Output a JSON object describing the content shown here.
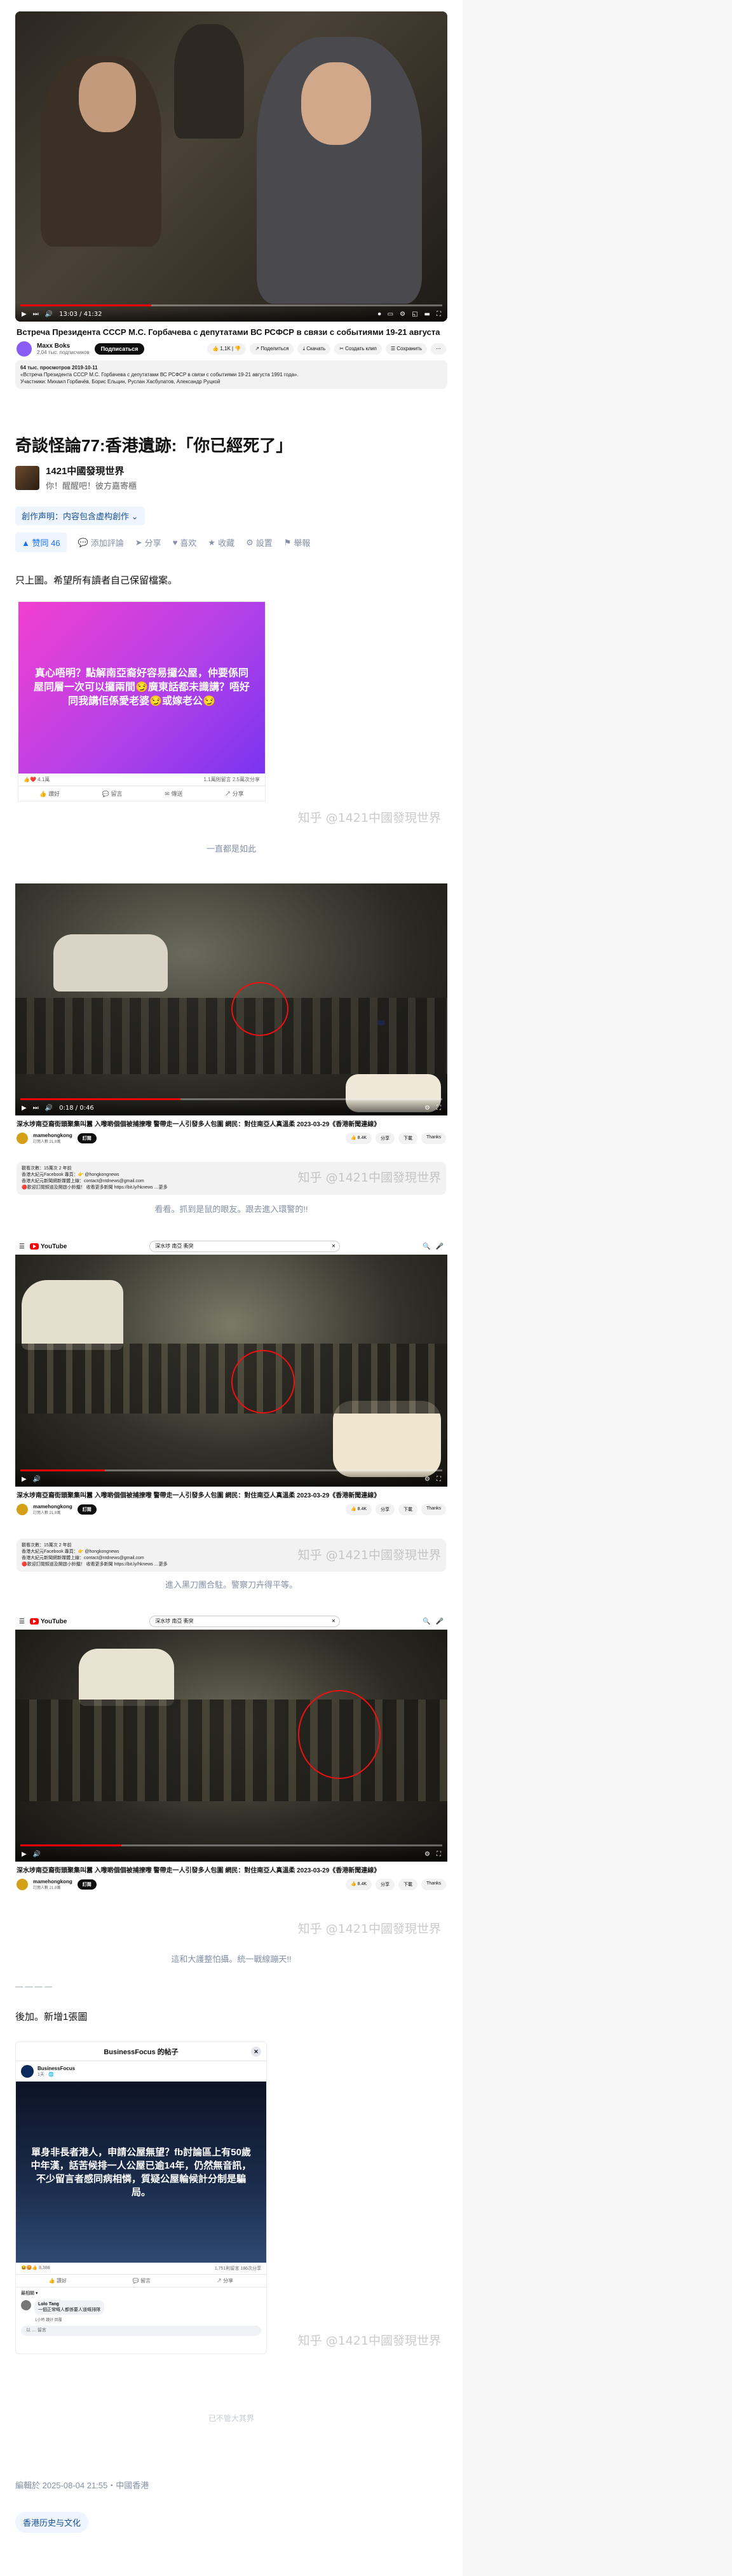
{
  "shot1": {
    "time": "13:03 / 41:32",
    "title": "Встреча Президента СССР М.С. Горбачева с депутатами ВС РСФСР в связи с событиями 19-21 августа",
    "channel": "Maxx Boks",
    "subs": "2,04 тыс. подписчиков",
    "subscribe": "Подписаться",
    "likes": "1,1K",
    "share": "Поделиться",
    "download": "Скачать",
    "clip": "Создать клип",
    "save": "Сохранить",
    "more": "⋯",
    "desc_views": "64 тыс. просмотров  2019-10-11",
    "desc_text": "«Встреча Президента СССР М.С. Горбачева с депутатами ВС РСФСР в связи с событиями 19-21 августа 1991 года».",
    "desc_people": "Участники: Михаил Горбачёв, Борис Ельцин, Руслан Хасбулатов, Александр Руцкой"
  },
  "article": {
    "title": "奇談怪論77:香港遺跡:「你已經死了」",
    "author_name": "1421中國發現世界",
    "author_bio": "你！醒醒吧！彼方嘉寄櫃",
    "creation_statement": "創作声明：内容包含虚构創作",
    "vote": "赞同 46",
    "comment": "添加評論",
    "share": "分享",
    "like": "喜欢",
    "collect": "收藏",
    "settings": "設置",
    "report": "舉報",
    "intro": "只上圖。希望所有讀者自己保留檔案。",
    "watermark": "知乎 @1421中國發現世界"
  },
  "post1": {
    "text": "真心唔明？點解南亞裔好容易攞公屋，仲要係同屋同層一次可以攞兩間😏廣東話都未識講？唔好同我講佢係愛老婆😏或嫁老公😏",
    "footer_left": "👍❤️ 4.1萬",
    "footer_right": "1.1萬則留言 2.5萬次分享",
    "like": "讚好",
    "comment": "留言",
    "send": "傳送",
    "share": "分享"
  },
  "caption1": "一直都是如此",
  "yt1": {
    "time": "0:18 / 0:46",
    "title": "深水埗南亞裔街頭聚集叫囂 入嚟啲個個被捕撩嚟 警帶走一人引發多人包圍 網民：對住南亞人真溫柔 2023-03-29《香港新聞連線》",
    "channel": "mamehongkong",
    "subs": "訂閱人數 21.8萬",
    "subscribe": "訂閱",
    "like": "8.4K",
    "share": "分享",
    "download": "下載",
    "thanks": "Thanks",
    "desc1": "觀看次數：15萬次 2 年前",
    "desc2": "香港大紀元Facebook 專頁：👉 @hongkongnews",
    "desc3": "香港大紀元新聞網新媒體上線：contact@ntdnews@gmail.com",
    "desc4": "🔴歡迎訂閱頻道及開啟小鈴鐺！ 收看更多新聞 https://bit.ly/hknews …更多"
  },
  "caption2": "看看。抓到是鼠的眼友。跟去進入環警的!!",
  "ytsearch": "深水埗 南亞 衝突",
  "caption3": "進入黑刀團合駐。警察刀卉得平等。",
  "caption4": "這和大護整怕攝。統一戰線蹦天!!",
  "separator": "— — — —",
  "addendum": "後加。新增1張圖",
  "bf": {
    "header": "BusinessFocus 的帖子",
    "page": "BusinessFocus",
    "time": "1天 · 🌐",
    "text": "單身非長者港人，申請公屋無望？fb討論區上有50歲中年漢，話苦候排一人公屋已逾14年，仍然無音訊，不少留言者感同病相憐，質疑公屋輪候計分制是騙局。",
    "reactions": "😆😡👍 8,388",
    "stats": "1,751則留言 186次分享",
    "like": "讚好",
    "comment": "留言",
    "share": "分享",
    "sort": "最相關 ▾",
    "commenter": "Lolo Tang",
    "comment_text": "一個正常嘅人都係要人道嘅排隊",
    "comment_meta": "1小時 讚好 回覆",
    "input": "以 … 留言"
  },
  "end_mark": "已不管大其界",
  "edited": "編輯於 2025-08-04 21:55・中國香港",
  "topic_tag": "香港历史与文化"
}
